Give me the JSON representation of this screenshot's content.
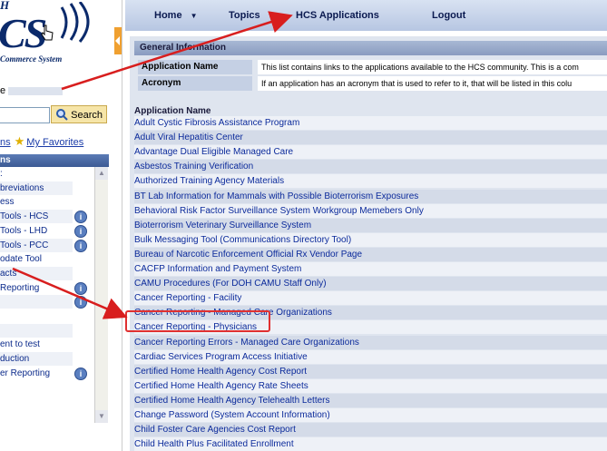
{
  "logo": {
    "top_text": "H",
    "main_text": "CS",
    "subtitle": "Commerce System"
  },
  "left": {
    "welcome_label": "e",
    "search_button": "Search",
    "favorites_prefix": "ns",
    "favorites_link": "My Favorites",
    "applications_header": "ns",
    "items": [
      {
        "label": ":"
      },
      {
        "label": "breviations"
      },
      {
        "label": "ess"
      },
      {
        "label": "Tools - HCS"
      },
      {
        "label": "Tools - LHD"
      },
      {
        "label": "Tools - PCC"
      },
      {
        "label": "odate Tool"
      },
      {
        "label": "acts"
      },
      {
        "label": "Reporting"
      },
      {
        "label": ""
      },
      {
        "label": ""
      },
      {
        "label": ""
      },
      {
        "label": "ent to test"
      },
      {
        "label": "duction"
      },
      {
        "label": "er Reporting"
      }
    ]
  },
  "nav": {
    "home": "Home",
    "topics": "Topics",
    "hcs_applications": "HCS Applications",
    "logout": "Logout"
  },
  "general_info": {
    "title": "General Information",
    "app_name_label": "Application Name",
    "app_name_value": "This list contains links to the applications available to the HCS community. This is a com",
    "acronym_label": "Acronym",
    "acronym_value": "If an application has an acronym that is used to refer to it, that will be listed in this colu"
  },
  "applications": {
    "header": "Application Name",
    "items": [
      "Adult Cystic Fibrosis Assistance Program",
      "Adult Viral Hepatitis Center",
      "Advantage Dual Eligible Managed Care",
      "Asbestos Training Verification",
      "Authorized Training Agency Materials",
      "BT Lab Information for Mammals with Possible Bioterrorism Exposures",
      "Behavioral Risk Factor Surveillance System Workgroup Memebers Only",
      "Bioterrorism Veterinary Surveillance System",
      "Bulk Messaging Tool (Communications Directory Tool)",
      "Bureau of Narcotic Enforcement Official Rx Vendor Page",
      "CACFP Information and Payment System",
      "CAMU Procedures (For DOH CAMU Staff Only)",
      "Cancer Reporting - Facility",
      "Cancer Reporting - Managed Care Organizations",
      "Cancer Reporting - Physicians",
      "Cancer Reporting Errors - Managed Care Organizations",
      "Cardiac Services Program Access Initiative",
      "Certified Home Health Agency Cost Report",
      "Certified Home Health Agency Rate Sheets",
      "Certified Home Health Agency Telehealth Letters",
      "Change Password (System Account Information)",
      "Child Foster Care Agencies Cost Report",
      "Child Health Plus Facilitated Enrollment"
    ]
  },
  "colors": {
    "nav_bg": "#c4d2ea",
    "panel_bg": "#dfe5ef",
    "link": "#0b2a9b",
    "highlight": "#e03030",
    "arrow": "#d81e1e"
  }
}
